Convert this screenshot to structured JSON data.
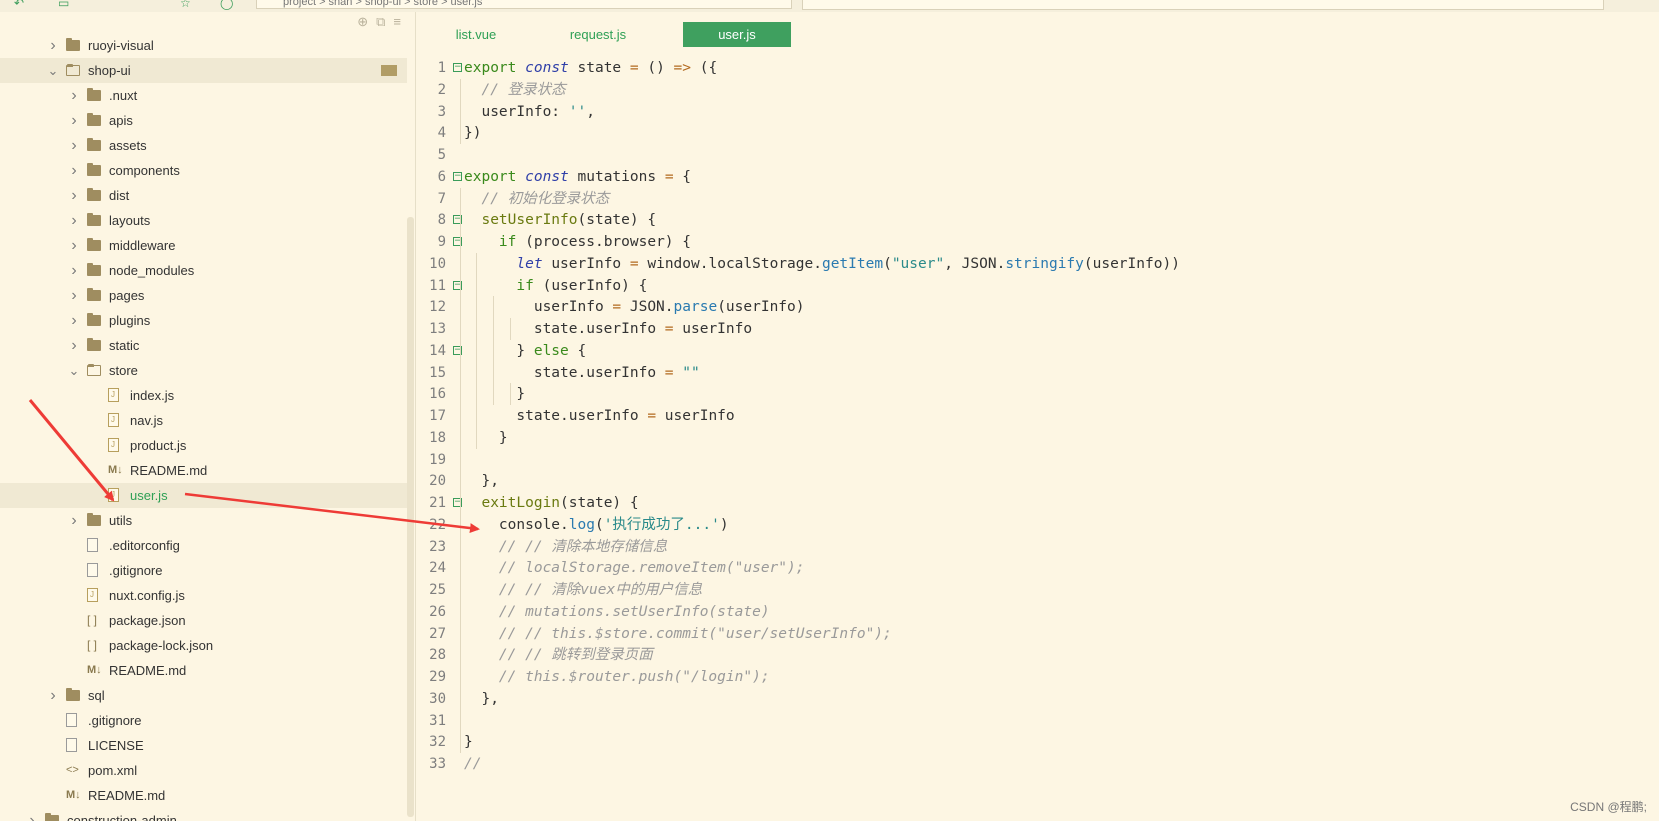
{
  "topbar": {
    "breadcrumb": "project > shan > shop-ui > store > user.js",
    "search_placeholder": ""
  },
  "sidebar": {
    "items": [
      {
        "label": "ruoyi-visual",
        "type": "folder",
        "depth": 1,
        "expanded": false
      },
      {
        "label": "shop-ui",
        "type": "folder",
        "depth": 1,
        "expanded": true
      },
      {
        "label": ".nuxt",
        "type": "folder",
        "depth": 2,
        "expanded": false
      },
      {
        "label": "apis",
        "type": "folder",
        "depth": 2,
        "expanded": false
      },
      {
        "label": "assets",
        "type": "folder",
        "depth": 2,
        "expanded": false
      },
      {
        "label": "components",
        "type": "folder",
        "depth": 2,
        "expanded": false
      },
      {
        "label": "dist",
        "type": "folder",
        "depth": 2,
        "expanded": false
      },
      {
        "label": "layouts",
        "type": "folder",
        "depth": 2,
        "expanded": false
      },
      {
        "label": "middleware",
        "type": "folder",
        "depth": 2,
        "expanded": false
      },
      {
        "label": "node_modules",
        "type": "folder",
        "depth": 2,
        "expanded": false
      },
      {
        "label": "pages",
        "type": "folder",
        "depth": 2,
        "expanded": false
      },
      {
        "label": "plugins",
        "type": "folder",
        "depth": 2,
        "expanded": false
      },
      {
        "label": "static",
        "type": "folder",
        "depth": 2,
        "expanded": false
      },
      {
        "label": "store",
        "type": "folder",
        "depth": 2,
        "expanded": true
      },
      {
        "label": "index.js",
        "type": "js",
        "depth": 3
      },
      {
        "label": "nav.js",
        "type": "js",
        "depth": 3
      },
      {
        "label": "product.js",
        "type": "js",
        "depth": 3
      },
      {
        "label": "README.md",
        "type": "md",
        "depth": 3
      },
      {
        "label": "user.js",
        "type": "js",
        "depth": 3,
        "selected": true
      },
      {
        "label": "utils",
        "type": "folder",
        "depth": 2,
        "expanded": false
      },
      {
        "label": ".editorconfig",
        "type": "plain",
        "depth": 2
      },
      {
        "label": ".gitignore",
        "type": "plain",
        "depth": 2
      },
      {
        "label": "nuxt.config.js",
        "type": "js",
        "depth": 2
      },
      {
        "label": "package.json",
        "type": "json",
        "depth": 2
      },
      {
        "label": "package-lock.json",
        "type": "json",
        "depth": 2
      },
      {
        "label": "README.md",
        "type": "md",
        "depth": 2
      },
      {
        "label": "sql",
        "type": "folder",
        "depth": 1,
        "expanded": false
      },
      {
        "label": ".gitignore",
        "type": "plain",
        "depth": 1
      },
      {
        "label": "LICENSE",
        "type": "plain",
        "depth": 1
      },
      {
        "label": "pom.xml",
        "type": "xml",
        "depth": 1
      },
      {
        "label": "README.md",
        "type": "md",
        "depth": 1
      },
      {
        "label": "construction-admin",
        "type": "folder",
        "depth": 0,
        "expanded": false
      }
    ]
  },
  "tabs": [
    {
      "label": "list.vue",
      "active": false
    },
    {
      "label": "request.js",
      "active": false
    },
    {
      "label": "user.js",
      "active": true
    }
  ],
  "code_lines": [
    "export const state = () => ({",
    "  // 登录状态",
    "  userInfo: '',",
    "})",
    "",
    "export const mutations = {",
    "  // 初始化登录状态",
    "  setUserInfo(state) {",
    "    if (process.browser) {",
    "      let userInfo = window.localStorage.getItem(\"user\", JSON.stringify(userInfo))",
    "      if (userInfo) {",
    "        userInfo = JSON.parse(userInfo)",
    "        state.userInfo = userInfo",
    "      } else {",
    "        state.userInfo = \"\"",
    "      }",
    "      state.userInfo = userInfo",
    "    }",
    "",
    "  },",
    "  exitLogin(state) {",
    "    console.log('执行成功了...')",
    "    // // 清除本地存储信息",
    "    // localStorage.removeItem(\"user\");",
    "    // // 清除vuex中的用户信息",
    "    // mutations.setUserInfo(state)",
    "    // // this.$store.commit(\"user/setUserInfo\");",
    "    // // 跳转到登录页面",
    "    // this.$router.push(\"/login\");",
    "  },",
    "",
    "}",
    "//"
  ],
  "watermark": "CSDN @程鹏;"
}
